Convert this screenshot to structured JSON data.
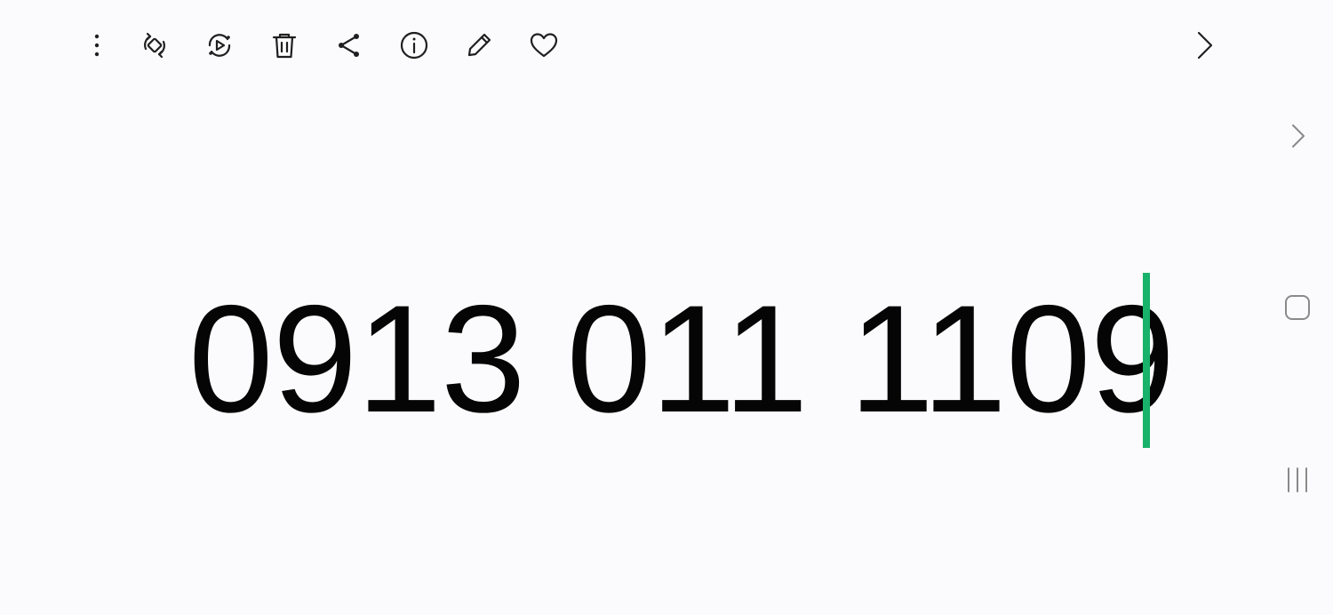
{
  "toolbar": {
    "icons": [
      "more-vertical-icon",
      "rotate-icon",
      "motion-photo-icon",
      "trash-icon",
      "share-icon",
      "info-icon",
      "edit-pencil-icon",
      "heart-icon",
      "chevron-right-icon"
    ]
  },
  "content": {
    "text": "0913 011 1109",
    "cursor_color": "#18b26a"
  },
  "navigation": {
    "icons": [
      "back-chevron-icon",
      "home-square-icon",
      "recent-apps-icon"
    ]
  }
}
